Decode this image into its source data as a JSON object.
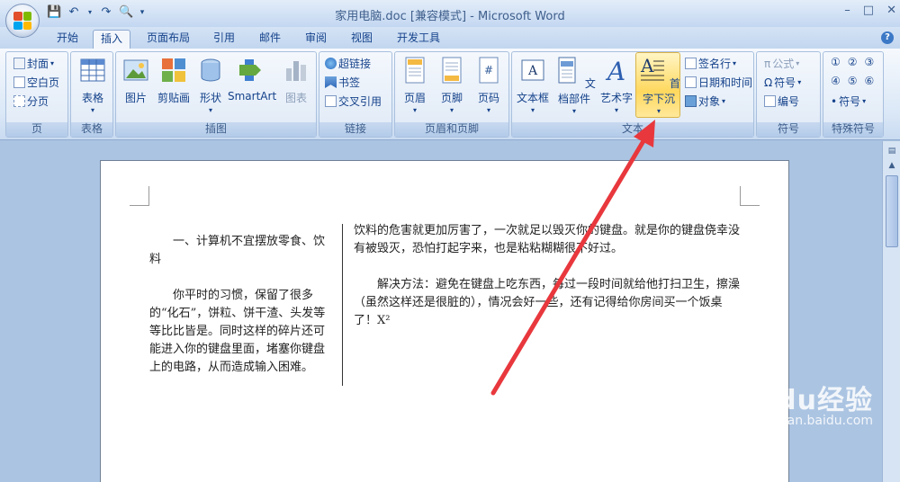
{
  "window": {
    "title": "家用电脑.doc [兼容模式] - Microsoft Word",
    "controls": [
      "–",
      "□",
      "✕"
    ]
  },
  "tabs": [
    "开始",
    "插入",
    "页面布局",
    "引用",
    "邮件",
    "审阅",
    "视图",
    "开发工具"
  ],
  "active_tab": "插入",
  "ribbon": {
    "page_group": {
      "label": "页",
      "items": [
        "封面",
        "空白页",
        "分页"
      ]
    },
    "table_group": {
      "label": "表格",
      "button": "表格"
    },
    "illustrations_group": {
      "label": "插图",
      "buttons": [
        "图片",
        "剪贴画",
        "形状",
        "SmartArt",
        "图表"
      ]
    },
    "links_group": {
      "label": "链接",
      "items": [
        "超链接",
        "书签",
        "交叉引用"
      ]
    },
    "header_footer_group": {
      "label": "页眉和页脚",
      "buttons": [
        "页眉",
        "页脚",
        "页码"
      ]
    },
    "text_group": {
      "label": "文本",
      "buttons": [
        "文本框",
        "文档部件",
        "艺术字",
        "首字下沉"
      ],
      "items": [
        "签名行",
        "日期和时间",
        "对象"
      ]
    },
    "symbols_group": {
      "label": "符号",
      "items": [
        "公式",
        "符号",
        "编号"
      ]
    },
    "special_group": {
      "label": "特殊符号",
      "row1": [
        "①",
        "②",
        "③"
      ],
      "row2": [
        "④",
        "⑤",
        "⑥"
      ],
      "item": "符号"
    }
  },
  "document": {
    "col1": {
      "heading": "一、计算机不宜摆放零食、饮料",
      "para": "你平时的习惯，保留了很多的“化石”，饼粒、饼干渣、头发等等比比皆是。同时这样的碎片还可能进入你的键盘里面，堵塞你键盘上的电路，从而造成输入困难。"
    },
    "col2": {
      "para1": "饮料的危害就更加厉害了，一次就足以毁灭你的键盘。就是你的键盘侥幸没有被毁灭，恐怕打起字来，也是粘粘糊糊很不好过。",
      "para2": "解决方法：避免在键盘上吃东西，每过一段时间就给他打扫卫生，擦澡（虽然这样还是很脏的），情况会好一些，还有记得给你房间买一个饭桌了！X²"
    }
  },
  "watermark": {
    "brand": "Baidu经验",
    "url": "jingyan.baidu.com"
  },
  "colors": {
    "arrow": "#e8383d",
    "ribbon_accent": "#15428b",
    "highlight": "#ffd85e"
  }
}
